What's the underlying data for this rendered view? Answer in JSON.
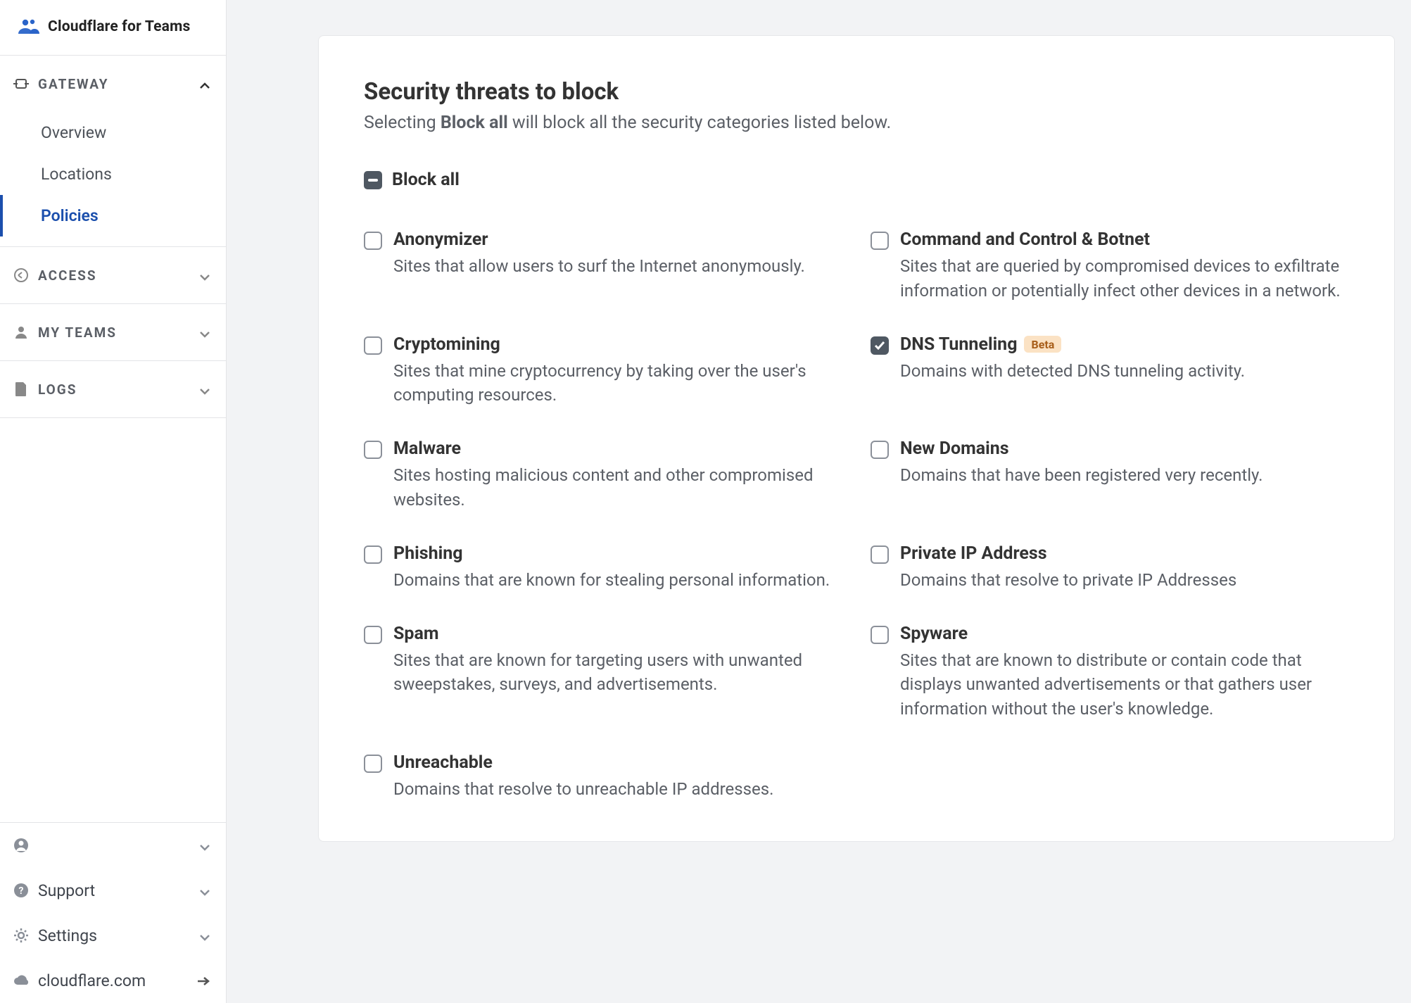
{
  "brand": {
    "name": "Cloudflare for Teams"
  },
  "nav": {
    "gateway": {
      "label": "Gateway"
    },
    "sub": {
      "overview": "Overview",
      "locations": "Locations",
      "policies": "Policies"
    },
    "access": {
      "label": "Access"
    },
    "myteams": {
      "label": "My Teams"
    },
    "logs": {
      "label": "Logs"
    }
  },
  "footer": {
    "support": "Support",
    "settings": "Settings",
    "cfcom": "cloudflare.com"
  },
  "page": {
    "title": "Security threats to block",
    "subtitle_pre": "Selecting ",
    "subtitle_bold": "Block all",
    "subtitle_post": " will block all the security categories listed below.",
    "block_all_label": "Block all",
    "beta_label": "Beta"
  },
  "threats": {
    "anonymizer": {
      "title": "Anonymizer",
      "desc": "Sites that allow users to surf the Internet anonymously."
    },
    "cc_botnet": {
      "title": "Command and Control & Botnet",
      "desc": "Sites that are queried by compromised devices to exfiltrate information or potentially infect other devices in a network."
    },
    "cryptomining": {
      "title": "Cryptomining",
      "desc": "Sites that mine cryptocurrency by taking over the user's computing resources."
    },
    "dns_tunneling": {
      "title": "DNS Tunneling",
      "desc": "Domains with detected DNS tunneling activity."
    },
    "malware": {
      "title": "Malware",
      "desc": "Sites hosting malicious content and other compromised websites."
    },
    "new_domains": {
      "title": "New Domains",
      "desc": "Domains that have been registered very recently."
    },
    "phishing": {
      "title": "Phishing",
      "desc": "Domains that are known for stealing personal information."
    },
    "private_ip": {
      "title": "Private IP Address",
      "desc": "Domains that resolve to private IP Addresses"
    },
    "spam": {
      "title": "Spam",
      "desc": "Sites that are known for targeting users with unwanted sweepstakes, surveys, and advertisements."
    },
    "spyware": {
      "title": "Spyware",
      "desc": "Sites that are known to distribute or contain code that displays unwanted advertisements or that gathers user information without the user's knowledge."
    },
    "unreachable": {
      "title": "Unreachable",
      "desc": "Domains that resolve to unreachable IP addresses."
    }
  }
}
